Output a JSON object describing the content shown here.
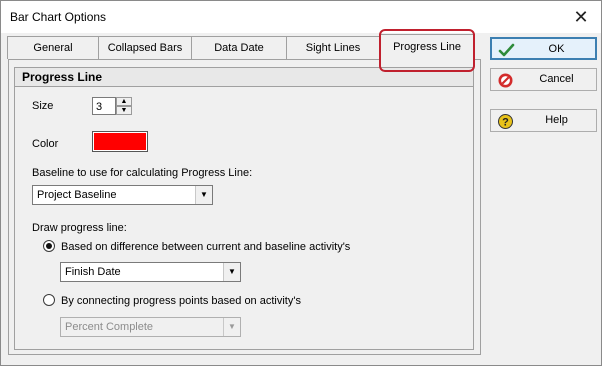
{
  "window": {
    "title": "Bar Chart Options"
  },
  "tabs": [
    {
      "label": "General"
    },
    {
      "label": "Collapsed Bars"
    },
    {
      "label": "Data Date"
    },
    {
      "label": "Sight Lines"
    },
    {
      "label": "Progress Line"
    }
  ],
  "group": {
    "title": "Progress Line",
    "size_label": "Size",
    "size_value": "3",
    "color_label": "Color",
    "color_value": "#ff0000",
    "baseline_label": "Baseline to use for calculating Progress Line:",
    "baseline_value": "Project Baseline",
    "draw_label": "Draw progress line:",
    "option1_label": "Based on difference between current and baseline activity's",
    "option1_value": "Finish Date",
    "option2_label": "By connecting progress points based on activity's",
    "option2_value": "Percent Complete"
  },
  "buttons": {
    "ok": "OK",
    "cancel": "Cancel",
    "help": "Help"
  },
  "icons": {
    "close": "close-icon",
    "ok": "checkmark-icon",
    "cancel": "cancel-icon",
    "help": "help-icon"
  },
  "colors": {
    "highlight": "#c0202e",
    "ok_check": "#2e8b3a",
    "cancel_icon": "#d32b2b",
    "help_icon": "#e8c21a"
  }
}
